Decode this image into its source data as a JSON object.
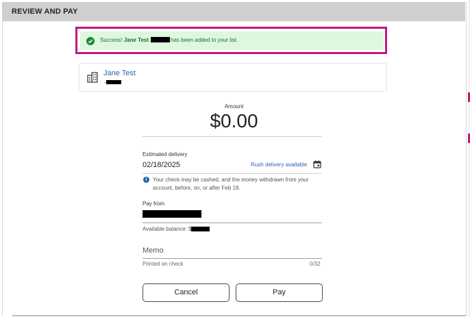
{
  "header": {
    "title": "REVIEW AND PAY"
  },
  "notification": {
    "prefix": "Success!",
    "name": "Jane Test",
    "suffix": "has been added to your list."
  },
  "payee": {
    "name": "Jane Test",
    "sub_prefix": "-"
  },
  "amount": {
    "label": "Amount",
    "value": "$0.00"
  },
  "delivery": {
    "label": "Estimated delivery",
    "date": "02/18/2025",
    "rush_link": "Rush delivery available",
    "info": "Your check may be cashed, and the money withdrawn from your account, before, on, or after Feb 18."
  },
  "pay_from": {
    "label": "Pay from",
    "balance_label": "Available balance: $"
  },
  "memo": {
    "placeholder": "Memo",
    "helper": "Printed on check",
    "counter": "0/32"
  },
  "buttons": {
    "cancel": "Cancel",
    "pay": "Pay"
  },
  "colors": {
    "highlight": "#c2187a",
    "success_bg": "#dff7df",
    "success_icon": "#1b8a3c",
    "link": "#2a63b8"
  },
  "icons": [
    "check-circle-icon",
    "building-icon",
    "calendar-icon",
    "info-icon"
  ]
}
